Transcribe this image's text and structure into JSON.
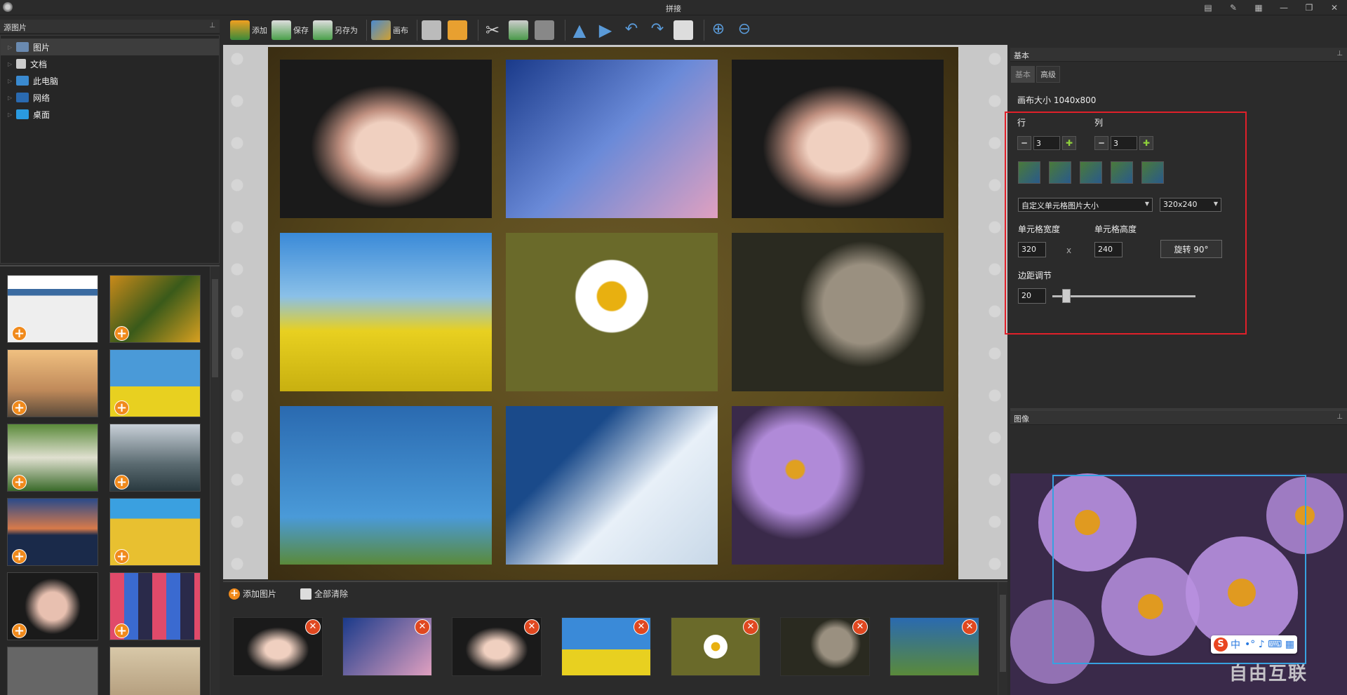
{
  "window": {
    "title": "拼接"
  },
  "source_panel": {
    "title": "源图片",
    "tree": [
      "图片",
      "文档",
      "此电脑",
      "网络",
      "桌面"
    ]
  },
  "toolbar": {
    "add": "添加",
    "save": "保存",
    "save_as": "另存为",
    "canvas": "画布"
  },
  "strip": {
    "add_label": "添加图片",
    "clear_label": "全部清除",
    "remove_glyph": "✕"
  },
  "basic_panel": {
    "title": "基本",
    "tabs": [
      "基本",
      "高级"
    ],
    "canvas_size_label": "画布大小",
    "canvas_size_value": "1040x800",
    "rows_label": "行",
    "cols_label": "列",
    "rows_value": "3",
    "cols_value": "3",
    "cell_mode": "自定义单元格图片大小",
    "cell_preset": "320x240",
    "cell_width_label": "单元格宽度",
    "cell_height_label": "单元格高度",
    "cell_width": "320",
    "cell_height": "240",
    "times": "x",
    "rotate_label": "旋转 90°",
    "margin_label": "边距调节",
    "margin_value": "20",
    "margin_slider_fraction": 0.1
  },
  "image_panel": {
    "title": "图像"
  },
  "ime": {
    "logo": "S",
    "lang": "中",
    "symbols": "•° ♪ ⌨ ▦"
  },
  "watermark": {
    "text": "自由互联"
  },
  "icons": {
    "minus": "━",
    "plus": "✚",
    "caret": "▼",
    "pin": "📌"
  },
  "colors": {
    "accent_orange": "#f08a1c",
    "highlight_red": "#e0202a",
    "crop_blue": "#37a2e0",
    "plus_green": "#8fd13b"
  }
}
